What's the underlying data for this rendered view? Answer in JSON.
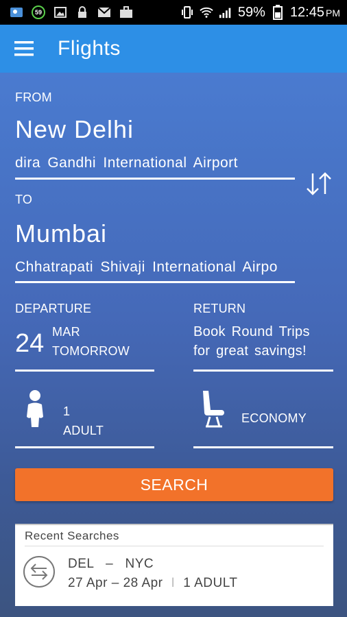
{
  "status_bar": {
    "notification_badge": "59",
    "battery": "59%",
    "time": "12:45",
    "ampm": "PM"
  },
  "app_bar": {
    "title": "Flights",
    "menu_icon": "hamburger-icon"
  },
  "from": {
    "label": "FROM",
    "city": "New Delhi",
    "airport": "dira Gandhi International Airport"
  },
  "to": {
    "label": "TO",
    "city": "Mumbai",
    "airport": "Chhatrapati Shivaji International Airpo"
  },
  "departure": {
    "label": "DEPARTURE",
    "day": "24",
    "month": "MAR",
    "relative": "TOMORROW"
  },
  "return": {
    "label": "RETURN",
    "line1": "Book Round Trips",
    "line2": "for great savings!"
  },
  "passengers": {
    "count": "1",
    "type": "ADULT"
  },
  "cabin": {
    "class": "ECONOMY"
  },
  "search_button": "SEARCH",
  "recent_searches": {
    "title": "Recent Searches",
    "items": [
      {
        "from": "DEL",
        "dash": "–",
        "to": "NYC",
        "depart": "27 Apr",
        "date_dash": "–",
        "return": "28 Apr",
        "separator": "I",
        "travellers": "1 ADULT"
      }
    ]
  },
  "colors": {
    "app_bar": "#2d8fe6",
    "accent_orange": "#f2722a",
    "background_top": "#4a7bd0",
    "background_bottom": "#3c5480"
  }
}
